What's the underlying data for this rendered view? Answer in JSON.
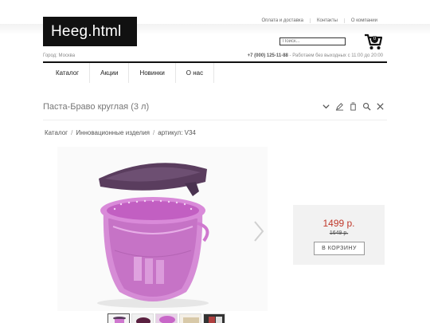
{
  "header": {
    "logo_text": "Heeg.html",
    "links": [
      "Оплата и доставка",
      "Контакты",
      "О компании"
    ],
    "search_placeholder": "Поиск...",
    "cart_count": "0",
    "city": "Город: Москва",
    "phone": "+7 (000) 125-11-88",
    "hours": " - Работаем без выходных с 11:00 до 20:00"
  },
  "nav": {
    "items": [
      "Каталог",
      "Акции",
      "Новинки",
      "О нас"
    ]
  },
  "product": {
    "title": "Паста-Браво круглая (3 л)",
    "breadcrumb": [
      "Каталог",
      "Инновационные изделия",
      "артикул: V34"
    ],
    "price": "1499 р.",
    "old_price": "1649 р.",
    "buy_label": "В КОРЗИНУ",
    "colors": {
      "bowl": "#c867c8",
      "lid": "#5a3d5e",
      "price": "#c0392b"
    }
  },
  "icons": {
    "title_actions": [
      "chevron-down-icon",
      "edit-icon",
      "copy-icon",
      "search-icon",
      "close-icon"
    ],
    "cart": "cart-icon",
    "gallery_next": "chevron-right-icon"
  }
}
